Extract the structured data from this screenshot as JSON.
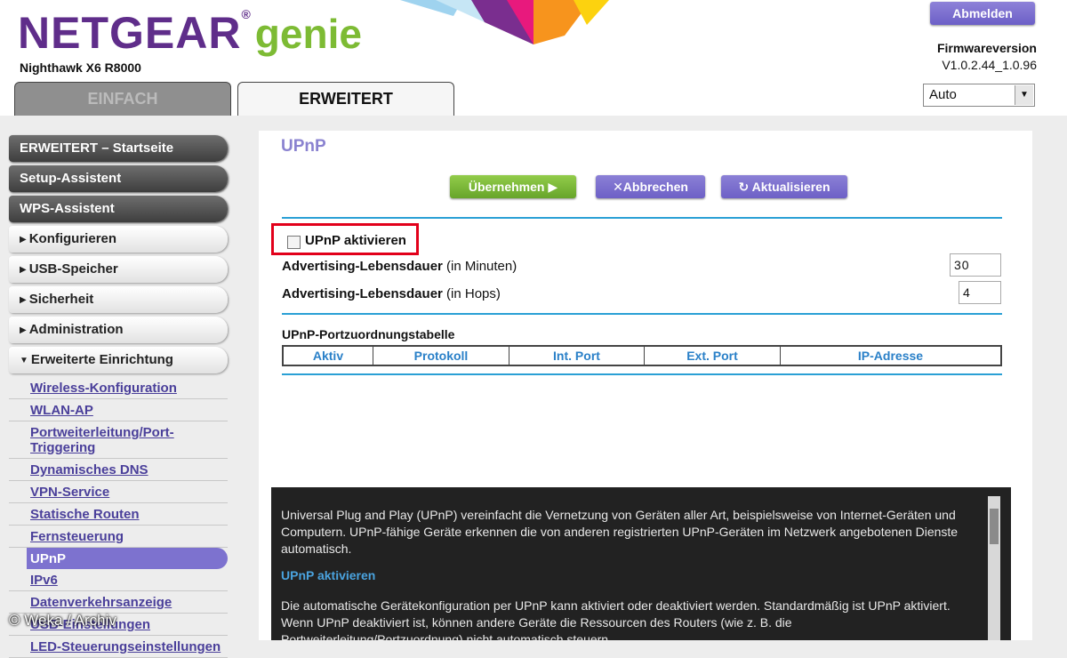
{
  "header": {
    "brand_netgear": "NETGEAR",
    "brand_reg": "®",
    "brand_genie": "genie",
    "model": "Nighthawk X6 R8000",
    "logout_label": "Abmelden",
    "firmware_label": "Firmwareversion",
    "firmware_value": "V1.0.2.44_1.0.96",
    "language_value": "Auto",
    "tabs": [
      {
        "label": "EINFACH",
        "active": false
      },
      {
        "label": "ERWEITERT",
        "active": true
      }
    ],
    "colors": {
      "brand": "#5f2d8a",
      "genie": "#7dbb34"
    }
  },
  "sidebar": {
    "main_items": [
      {
        "label": "ERWEITERT – Startseite",
        "style": "dark"
      },
      {
        "label": "Setup-Assistent",
        "style": "dark"
      },
      {
        "label": "WPS-Assistent",
        "style": "dark"
      }
    ],
    "sections": [
      {
        "label": "Konfigurieren",
        "icon": "triangle-right-icon",
        "glyph": "▶"
      },
      {
        "label": "USB-Speicher",
        "icon": "triangle-right-icon",
        "glyph": "▶"
      },
      {
        "label": "Sicherheit",
        "icon": "triangle-right-icon",
        "glyph": "▶"
      },
      {
        "label": "Administration",
        "icon": "triangle-right-icon",
        "glyph": "▶"
      },
      {
        "label": "Erweiterte Einrichtung",
        "icon": "triangle-down-icon",
        "glyph": "▼"
      }
    ],
    "sub_items": [
      {
        "label": "Wireless-Konfiguration",
        "active": false
      },
      {
        "label": "WLAN-AP",
        "active": false
      },
      {
        "label": "Portweiterleitung/Port-Triggering",
        "active": false
      },
      {
        "label": "Dynamisches DNS",
        "active": false
      },
      {
        "label": "VPN-Service",
        "active": false
      },
      {
        "label": "Statische Routen",
        "active": false
      },
      {
        "label": "Fernsteuerung",
        "active": false
      },
      {
        "label": "UPnP",
        "active": true
      },
      {
        "label": "IPv6",
        "active": false
      },
      {
        "label": "Datenverkehrsanzeige",
        "active": false
      },
      {
        "label": "USB-Einstellungen",
        "active": false
      },
      {
        "label": "LED-Steuerungseinstellungen",
        "active": false
      }
    ]
  },
  "main": {
    "title": "UPnP",
    "buttons": {
      "apply": "Übernehmen ▶",
      "cancel": "✕Abbrechen",
      "refresh": "↻ Aktualisieren"
    },
    "enable_label": "UPnP aktivieren",
    "enable_checked": false,
    "rows": [
      {
        "label_bold": "Advertising-Lebensdauer",
        "label_rest": " (in Minuten)",
        "value": "30"
      },
      {
        "label_bold": "Advertising-Lebensdauer",
        "label_rest": " (in Hops)",
        "value": "4"
      }
    ],
    "table_title": "UPnP-Portzuordnungstabelle",
    "table_columns": [
      "Aktiv",
      "Protokoll",
      "Int. Port",
      "Ext. Port",
      "IP-Adresse"
    ],
    "accent_color": "#2aa0d5"
  },
  "help": {
    "intro": "Universal Plug and Play (UPnP) vereinfacht die Vernetzung von Geräten aller Art, beispielsweise von Internet-Geräten und Computern. UPnP-fähige Geräte erkennen die von anderen registrierten UPnP-Geräten im Netzwerk angebotenen Dienste automatisch.",
    "heading": "UPnP aktivieren",
    "body": "Die automatische Gerätekonfiguration per UPnP kann aktiviert oder deaktiviert werden. Standardmäßig ist UPnP aktiviert. Wenn UPnP deaktiviert ist, können andere Geräte die Ressourcen des Routers (wie z. B. die Portweiterleitung/Portzuordnung) nicht automatisch steuern."
  },
  "watermark": "© Weka / Archiv"
}
